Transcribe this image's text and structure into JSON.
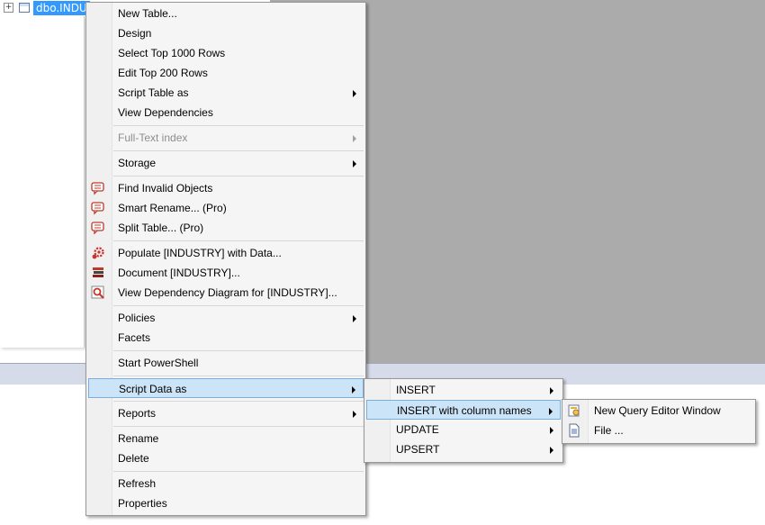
{
  "tree": {
    "node_label": "dbo.INDU",
    "expander_symbol": "+"
  },
  "context_menu": {
    "items": [
      {
        "label": "New Table..."
      },
      {
        "label": "Design"
      },
      {
        "label": "Select Top 1000 Rows"
      },
      {
        "label": "Edit Top 200 Rows"
      },
      {
        "label": "Script Table as"
      },
      {
        "label": "View Dependencies"
      },
      {
        "label": "Full-Text index"
      },
      {
        "label": "Storage"
      },
      {
        "label": "Find Invalid Objects"
      },
      {
        "label": "Smart Rename... (Pro)"
      },
      {
        "label": "Split Table... (Pro)"
      },
      {
        "label": "Populate [INDUSTRY] with Data..."
      },
      {
        "label": "Document [INDUSTRY]..."
      },
      {
        "label": "View Dependency Diagram for [INDUSTRY]..."
      },
      {
        "label": "Policies"
      },
      {
        "label": "Facets"
      },
      {
        "label": "Start PowerShell"
      },
      {
        "label": "Script Data as"
      },
      {
        "label": "Reports"
      },
      {
        "label": "Rename"
      },
      {
        "label": "Delete"
      },
      {
        "label": "Refresh"
      },
      {
        "label": "Properties"
      }
    ]
  },
  "script_data_submenu": {
    "items": [
      {
        "label": "INSERT"
      },
      {
        "label": "INSERT with column names"
      },
      {
        "label": "UPDATE"
      },
      {
        "label": "UPSERT"
      }
    ]
  },
  "insert_submenu": {
    "items": [
      {
        "label": "New Query Editor Window"
      },
      {
        "label": "File ..."
      }
    ]
  },
  "colors": {
    "highlight_bg": "#cce4f7",
    "highlight_border": "#7aaede",
    "selected_node": "#3399ff",
    "workspace_gray": "#ababab"
  }
}
